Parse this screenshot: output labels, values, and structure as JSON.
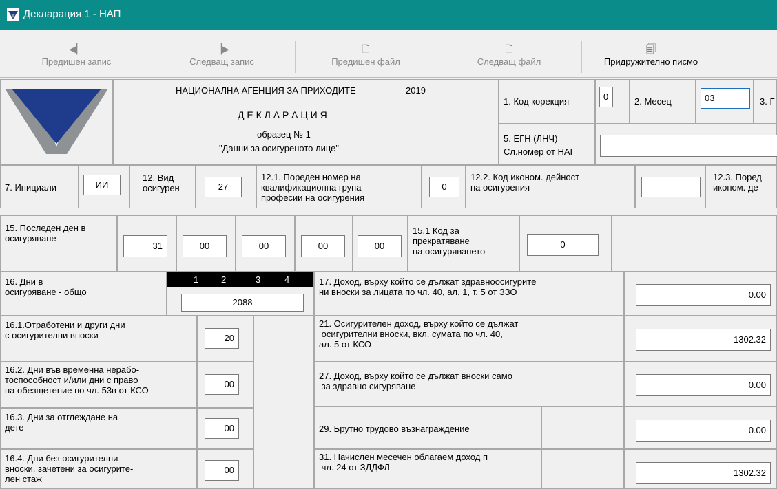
{
  "window": {
    "title": "Декларация 1 - НАП"
  },
  "toolbar": {
    "prev_record": "Предишен запис",
    "next_record": "Следващ запис",
    "prev_file": "Предишен файл",
    "next_file": "Следващ файл",
    "cover_letter": "Придружително писмо"
  },
  "header": {
    "agency": "НАЦИОНАЛНА АГЕНЦИЯ ЗА ПРИХОДИТЕ",
    "year": "2019",
    "doc_title": "Д Е К Л А Р А Ц И Я",
    "form_no": "образец № 1",
    "form_name": "\"Данни за осигуреното лице\""
  },
  "fields": {
    "f1_label": "1. Код корекция",
    "f1_value": "0",
    "f2_label": "2. Месец",
    "f2_value": "03",
    "f3_label": "3. Г",
    "f5_label": "5. ЕГН (ЛНЧ)",
    "f5_sub": "Сл.номер от НАГ",
    "f5_value": "",
    "f7_label": "7. Инициали",
    "f7_value": "ИИ",
    "f12_label": "12. Вид\nосигурен",
    "f12_value": "27",
    "f12_1_label": "12.1. Пореден номер на\nквалификационна група\nпрофесии на осигурения",
    "f12_1_value": "0",
    "f12_2_label": "12.2. Код иконом. дейност\nна осигурения",
    "f12_2_value": "",
    "f12_3_label": "12.3. Поред\nиконом. де",
    "f15_label": "15. Последен ден в\nосигуряване",
    "f15_values": [
      "31",
      "00",
      "00",
      "00",
      "00"
    ],
    "f15_1_label": "15.1 Код за\nпрекратяване\nна осигуряването",
    "f15_1_value": "0",
    "f16_label": "16. Дни в\nосигуряване - общо",
    "f16_cols": [
      "1",
      "2",
      "3",
      "4"
    ],
    "f16_value": "2088",
    "f16_1_label": "16.1.Отработени и други дни\nс осигурителни вноски",
    "f16_1_value": "20",
    "f16_2_label": "16.2. Дни във временна нерабо-\nтоспособност и/или дни с право\nна обезщетение по чл. 53в от КСО",
    "f16_2_value": "00",
    "f16_3_label": "16.3. Дни за отглеждане на\nдете",
    "f16_3_value": "00",
    "f16_4_label": "16.4. Дни без осигурителни\nвноски, зачетени за осигурите-\nлен стаж",
    "f16_4_value": "00",
    "f17_label": "17. Доход, върху който се дължат здравноосигурите\nни вноски за лицата по чл. 40, ал. 1, т. 5 от ЗЗО",
    "f17_value": "0.00",
    "f21_label": "21. Осигурителен доход, върху който се дължат\n осигурителни вноски, вкл. сумата по чл. 40,\nал. 5 от КСО",
    "f21_value": "1302.32",
    "f27_label": "27. Доход, върху който се дължат вноски само\n за здравно сигуряване",
    "f27_value": "0.00",
    "f29_label": "29. Брутно трудово възнаграждение",
    "f29_value": "0.00",
    "f31_label": "31. Начислен месечен облагаем доход п\n чл. 24 от ЗДДФЛ",
    "f31_value": "1302.32"
  }
}
